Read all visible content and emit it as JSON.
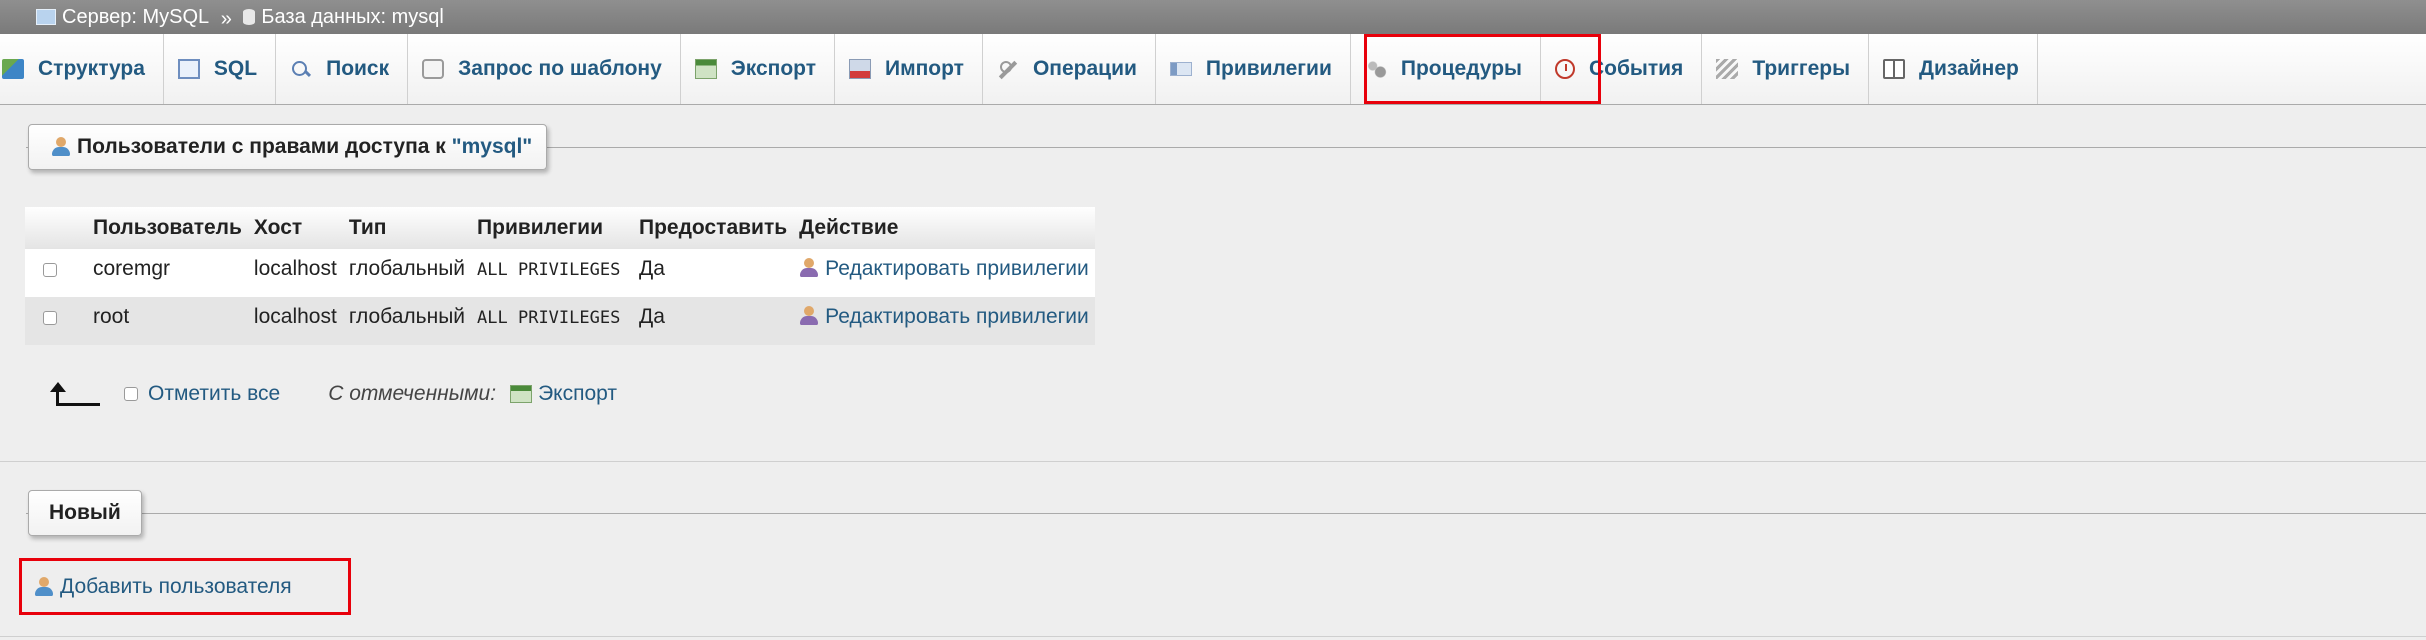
{
  "breadcrumb": {
    "server": "Сервер: MySQL",
    "separator": "»",
    "database": "База данных: mysql"
  },
  "tabs": [
    {
      "label": "Структура",
      "icon": "structure-icon"
    },
    {
      "label": "SQL",
      "icon": "sql-icon"
    },
    {
      "label": "Поиск",
      "icon": "search-icon"
    },
    {
      "label": "Запрос по шаблону",
      "icon": "query-icon"
    },
    {
      "label": "Экспорт",
      "icon": "export-icon"
    },
    {
      "label": "Импорт",
      "icon": "import-icon"
    },
    {
      "label": "Операции",
      "icon": "wrench-icon"
    },
    {
      "label": "Привилегии",
      "icon": "privileges-icon",
      "active": true
    },
    {
      "label": "Процедуры",
      "icon": "routines-icon"
    },
    {
      "label": "События",
      "icon": "clock-icon"
    },
    {
      "label": "Триггеры",
      "icon": "triggers-icon"
    },
    {
      "label": "Дизайнер",
      "icon": "designer-icon"
    }
  ],
  "users_section": {
    "legend_prefix": "Пользователи с правами доступа к ",
    "legend_db": "\"mysql\""
  },
  "table": {
    "headers": [
      "Пользователь",
      "Хост",
      "Тип",
      "Привилегии",
      "Предоставить",
      "Действие"
    ],
    "rows": [
      {
        "user": "coremgr",
        "host": "localhost",
        "type": "глобальный",
        "privileges": "ALL PRIVILEGES",
        "grant": "Да",
        "action": "Редактировать привилегии"
      },
      {
        "user": "root",
        "host": "localhost",
        "type": "глобальный",
        "privileges": "ALL PRIVILEGES",
        "grant": "Да",
        "action": "Редактировать привилегии"
      }
    ]
  },
  "bulk": {
    "check_all": "Отметить все",
    "with_selected": "С отмеченными:",
    "export": "Экспорт"
  },
  "new_section": {
    "legend": "Новый",
    "add_user": "Добавить пользователя"
  },
  "colors": {
    "link": "#235a81",
    "highlight": "#e8000b"
  }
}
